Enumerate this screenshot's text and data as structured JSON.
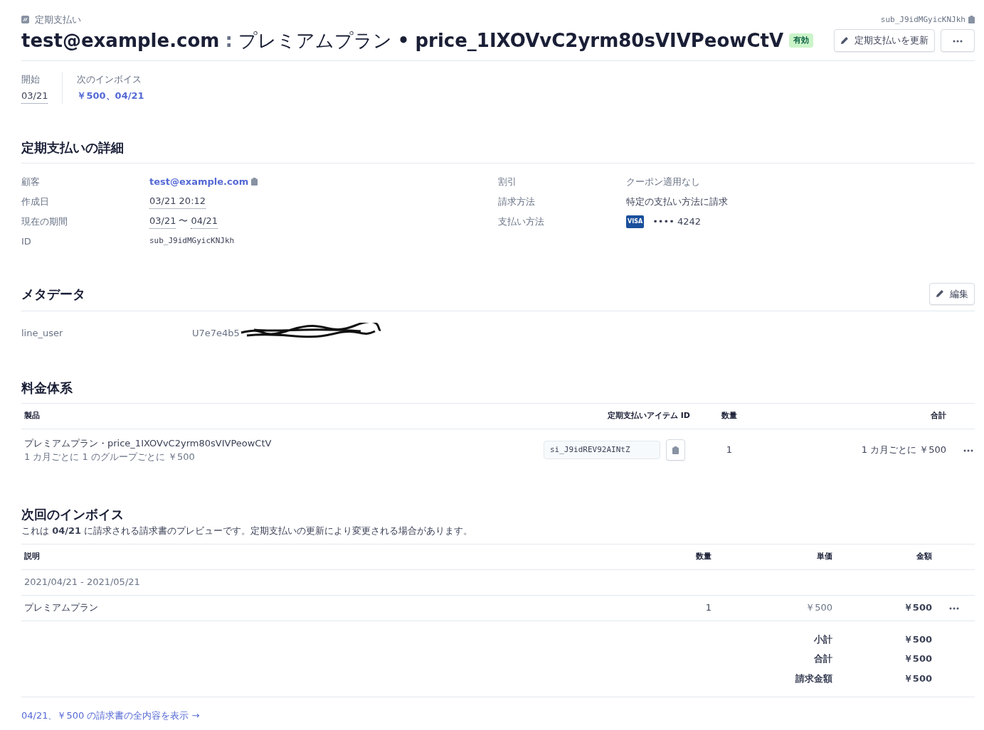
{
  "header": {
    "kind_label": "定期支払い",
    "id": "sub_J9idMGyicKNJkh",
    "title_email": "test@example.com",
    "title_separator": ":",
    "title_plan": "プレミアムプラン",
    "title_dot": "•",
    "title_price": "price_1IXOVvC2yrm80sVIVPeowCtV",
    "status_badge": "有効",
    "update_button": "定期支払いを更新"
  },
  "summary": [
    {
      "label": "開始",
      "value": "03/21",
      "kind": "date"
    },
    {
      "label": "次のインボイス",
      "value": "￥500、04/21",
      "kind": "link"
    }
  ],
  "details": {
    "title": "定期支払いの詳細",
    "left": [
      {
        "label": "顧客",
        "value": "test@example.com",
        "kind": "link-copy"
      },
      {
        "label": "作成日",
        "value": "03/21 20:12",
        "kind": "date"
      },
      {
        "label": "現在の期間",
        "kind": "period",
        "from": "03/21",
        "sep": "〜",
        "to": "04/21"
      },
      {
        "label": "ID",
        "value": "sub_J9idMGyicKNJkh",
        "kind": "mono"
      }
    ],
    "right": [
      {
        "label": "割引",
        "value": "クーポン適用なし",
        "kind": "muted"
      },
      {
        "label": "請求方法",
        "value": "特定の支払い方法に請求",
        "kind": "plain"
      },
      {
        "label": "支払い方法",
        "value": "•••• 4242",
        "brand": "VISA",
        "kind": "card"
      }
    ]
  },
  "metadata": {
    "title": "メタデータ",
    "edit_button": "編集",
    "rows": [
      {
        "key": "line_user",
        "value": "U7e7e4b5",
        "redacted": true
      }
    ]
  },
  "pricing": {
    "title": "料金体系",
    "columns": [
      "製品",
      "定期支払いアイテム ID",
      "数量",
      "合計"
    ],
    "rows": [
      {
        "product": "プレミアムプラン・price_1IXOVvC2yrm80sVIVPeowCtV",
        "subtitle": "1 カ月ごとに 1 のグループごとに ￥500",
        "item_id": "si_J9idREV92AINtZ",
        "quantity": "1",
        "total": "1 カ月ごとに ￥500"
      }
    ]
  },
  "invoice": {
    "title": "次回のインボイス",
    "description": "これは **04/21** に請求される請求書のプレビューです。定期支払いの更新により変更される場合があります。",
    "columns": [
      "説明",
      "数量",
      "単価",
      "金額"
    ],
    "period": "2021/04/21 - 2021/05/21",
    "lines": [
      {
        "description": "プレミアムプラン",
        "quantity": "1",
        "unit_price": "￥500",
        "amount": "￥500"
      }
    ],
    "totals": [
      {
        "label": "小計",
        "value": "￥500"
      },
      {
        "label": "合計",
        "value": "￥500"
      },
      {
        "label": "請求金額",
        "value": "￥500"
      }
    ],
    "full_link": "04/21、￥500 の請求書の全内容を表示 →"
  }
}
